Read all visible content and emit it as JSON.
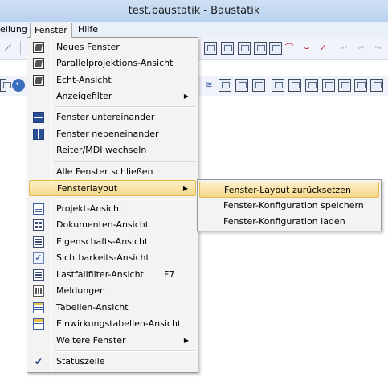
{
  "window": {
    "title": "test.baustatik - Baustatik"
  },
  "menubar": {
    "items": [
      {
        "label": "ellung"
      },
      {
        "label": "Fenster"
      },
      {
        "label": "Hilfe"
      }
    ]
  },
  "toolbar1": {
    "right_icons": [
      "steel-section-icon",
      "grid-save-icon",
      "profile-icon",
      "support-icon",
      "load-icon",
      "member-icon",
      "dim-icon",
      "load-arrow-icon",
      "moment-icon",
      "function-icon",
      "node-icon",
      "connect-icon",
      "dots-icon"
    ]
  },
  "fenster_menu": {
    "items": [
      {
        "label": "Neues Fenster",
        "icon": "cube-icon"
      },
      {
        "label": "Parallelprojektions-Ansicht",
        "icon": "cube-icon"
      },
      {
        "label": "Echt-Ansicht",
        "icon": "cube-icon"
      },
      {
        "label": "Anzeigefilter",
        "submenu": "▶"
      },
      {
        "label": "Fenster untereinander",
        "icon": "horizontal-split-icon"
      },
      {
        "label": "Fenster nebeneinander",
        "icon": "vertical-split-icon"
      },
      {
        "label": "Reiter/MDI wechseln"
      },
      {
        "label": "Alle Fenster schließen"
      },
      {
        "label": "Fensterlayout",
        "submenu": "▶"
      },
      {
        "label": "Projekt-Ansicht",
        "icon": "document-icon"
      },
      {
        "label": "Dokumenten-Ansicht",
        "icon": "grid-icon"
      },
      {
        "label": "Eigenschafts-Ansicht",
        "icon": "properties-icon"
      },
      {
        "label": "Sichtbarkeits-Ansicht",
        "icon": "checkbox-icon"
      },
      {
        "label": "Lastfallfilter-Ansicht",
        "icon": "filter-icon",
        "shortcut": "F7"
      },
      {
        "label": "Meldungen",
        "icon": "messages-icon"
      },
      {
        "label": "Tabellen-Ansicht",
        "icon": "table-icon"
      },
      {
        "label": "Einwirkungstabellen-Ansicht",
        "icon": "table-icon"
      },
      {
        "label": "Weitere Fenster",
        "submenu": "▶"
      },
      {
        "label": "Statuszeile",
        "icon": "checkmark-icon"
      }
    ]
  },
  "fensterlayout_submenu": {
    "items": [
      {
        "label": "Fenster-Layout zurücksetzen"
      },
      {
        "label": "Fenster-Konfiguration speichern"
      },
      {
        "label": "Fenster-Konfiguration laden"
      }
    ]
  },
  "colors": {
    "highlight": "#f5d98a",
    "menu_background": "#f3f3f3",
    "titlebar": "#c4d9f1"
  }
}
